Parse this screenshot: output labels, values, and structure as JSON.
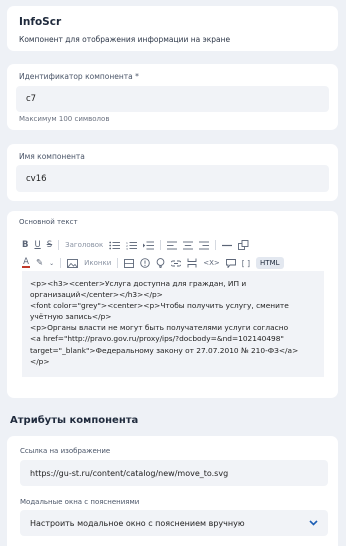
{
  "header": {
    "title": "InfoScr",
    "subtitle": "Компонент для отображения информации на экране"
  },
  "component_id": {
    "label": "Идентификатор компонента *",
    "value": "c7",
    "hint": "Максимум 100 символов"
  },
  "component_name": {
    "label": "Имя компонента",
    "value": "cv16"
  },
  "main_text": {
    "label": "Основной текст",
    "toolbar": {
      "heading_label": "Заголовок",
      "icons_label": "Иконки",
      "html_label": "HTML",
      "code_label": "<X>"
    },
    "content": "<p><h3><center>Услуга доступна для граждан, ИП и организаций</center></h3></p>\n<font color=\"grey\"><center><p>Чтобы получить услугу, смените учётную запись</p>\n<p>Органы власти не могут быть получателями услуги согласно\n<a href=\"http://pravo.gov.ru/proxy/ips/?docbody=&nd=102140498\" target=\"_blank\">Федеральному закону от 27.07.2010 № 210-ФЗ</a>\n</p>"
  },
  "attributes": {
    "section_title": "Атрибуты компонента",
    "image_link": {
      "label": "Ссылка на изображение",
      "value": "https://gu-st.ru/content/catalog/new/move_to.svg"
    },
    "modal": {
      "label": "Модальные окна с пояснениями",
      "value": "Настроить модальное окно с пояснением вручную"
    }
  },
  "colors": {
    "background": "#eef1f6",
    "card": "#ffffff",
    "field": "#f1f3f7",
    "accent": "#1d5fb5"
  }
}
